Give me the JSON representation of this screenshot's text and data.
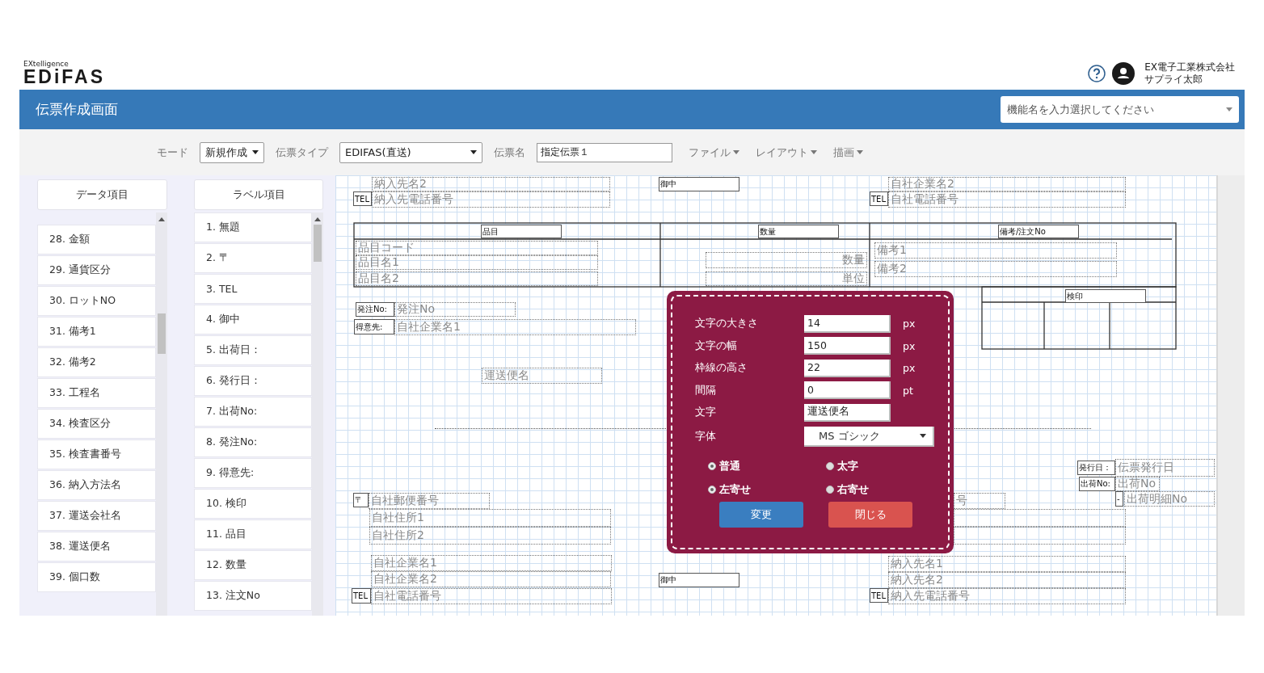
{
  "header": {
    "logo_tagline": "EXtelligence",
    "logo": "EDiFAS",
    "company": "EX電子工業株式会社",
    "user": "サプライ太郎"
  },
  "title_bar": {
    "title": "伝票作成画面",
    "function_search": {
      "placeholder": "機能名を入力選択してください"
    }
  },
  "toolbar": {
    "mode_label": "モード",
    "mode": "新規作成",
    "type_label": "伝票タイプ",
    "type": "EDIFAS(直送)",
    "name_label": "伝票名",
    "name": "指定伝票１",
    "menus": [
      "ファイル",
      "レイアウト",
      "描画"
    ]
  },
  "data_items": {
    "title": "データ項目",
    "items": [
      "28. 金額",
      "29. 通貨区分",
      "30. ロットNO",
      "31. 備考1",
      "32. 備考2",
      "33. 工程名",
      "34. 検査区分",
      "35. 検査書番号",
      "36. 納入方法名",
      "37. 運送会社名",
      "38. 運送便名",
      "39. 個口数"
    ]
  },
  "label_items": {
    "title": "ラベル項目",
    "items": [
      "1. 無題",
      "2. 〒",
      "3. TEL",
      "4. 御中",
      "5. 出荷日：",
      "6. 発行日：",
      "7. 出荷No:",
      "8. 発注No:",
      "9. 得意先:",
      "10. 検印",
      "11. 品目",
      "12. 数量",
      "13. 注文No"
    ]
  },
  "canvas": {
    "items": [
      {
        "kind": "data",
        "text": "納入先名2"
      },
      {
        "kind": "label",
        "text": "TEL"
      },
      {
        "kind": "data",
        "text": "納入先電話番号"
      },
      {
        "kind": "label",
        "text": "御中"
      },
      {
        "kind": "data",
        "text": "自社企業名2"
      },
      {
        "kind": "label",
        "text": "TEL"
      },
      {
        "kind": "data",
        "text": "自社電話番号"
      },
      {
        "kind": "label",
        "text": "品目"
      },
      {
        "kind": "label",
        "text": "数量"
      },
      {
        "kind": "label",
        "text": "備考/注文No"
      },
      {
        "kind": "data",
        "text": "品目コード"
      },
      {
        "kind": "data",
        "text": "品目名1"
      },
      {
        "kind": "data",
        "text": "品目名2"
      },
      {
        "kind": "data-right",
        "text": "数量"
      },
      {
        "kind": "data-right",
        "text": "単位"
      },
      {
        "kind": "data",
        "text": "備考1"
      },
      {
        "kind": "data",
        "text": "備考2"
      },
      {
        "kind": "label",
        "text": "検印"
      },
      {
        "kind": "label",
        "text": "発注No:"
      },
      {
        "kind": "data",
        "text": "発注No"
      },
      {
        "kind": "label",
        "text": "得意先:"
      },
      {
        "kind": "data",
        "text": "自社企業名1"
      },
      {
        "kind": "data",
        "text": "運送便名"
      },
      {
        "kind": "label",
        "text": "〒"
      },
      {
        "kind": "data",
        "text": "自社郵便番号"
      },
      {
        "kind": "data",
        "text": "自社住所1"
      },
      {
        "kind": "data",
        "text": "自社住所2"
      },
      {
        "kind": "data",
        "text": "号"
      },
      {
        "kind": "frame"
      },
      {
        "kind": "frame"
      },
      {
        "kind": "data",
        "text": "自社企業名1"
      },
      {
        "kind": "data",
        "text": "自社企業名2"
      },
      {
        "kind": "label",
        "text": "TEL"
      },
      {
        "kind": "data",
        "text": "自社電話番号"
      },
      {
        "kind": "label",
        "text": "御中"
      },
      {
        "kind": "data",
        "text": "納入先名1"
      },
      {
        "kind": "data",
        "text": "納入先名2"
      },
      {
        "kind": "label",
        "text": "TEL"
      },
      {
        "kind": "data",
        "text": "納入先電話番号"
      },
      {
        "kind": "label",
        "text": "発行日："
      },
      {
        "kind": "data",
        "text": "伝票発行日"
      },
      {
        "kind": "label",
        "text": "出荷No:"
      },
      {
        "kind": "data",
        "text": "出荷No"
      },
      {
        "kind": "label",
        "text": "-"
      },
      {
        "kind": "data",
        "text": "出荷明細No"
      }
    ]
  },
  "dialog": {
    "fields": [
      {
        "label": "文字の大きさ",
        "value": "14",
        "unit": "px"
      },
      {
        "label": "文字の幅",
        "value": "150",
        "unit": "px"
      },
      {
        "label": "枠線の高さ",
        "value": "22",
        "unit": "px"
      },
      {
        "label": "間隔",
        "value": "0",
        "unit": "pt"
      },
      {
        "label": "文字",
        "value": "運送便名"
      }
    ],
    "font": {
      "label": "字体",
      "value": "MS ゴシック"
    },
    "weight_options": [
      {
        "label": "普通",
        "selected": true
      },
      {
        "label": "太字",
        "selected": false
      }
    ],
    "align_options": [
      {
        "label": "左寄せ",
        "selected": true
      },
      {
        "label": "右寄せ",
        "selected": false
      }
    ],
    "buttons": [
      {
        "label": "変更",
        "kind": "primary"
      },
      {
        "label": "閉じる",
        "kind": "danger"
      }
    ]
  }
}
